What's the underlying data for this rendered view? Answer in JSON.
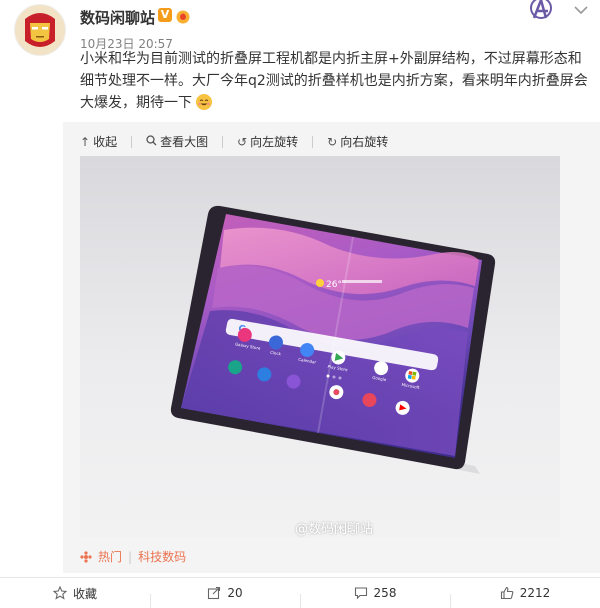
{
  "post": {
    "username": "数码闲聊站",
    "verified_badge": "V",
    "timestamp": "10月23日 20:57",
    "text": "小米和华为目前测试的折叠屏工程机都是内折主屏+外副屏结构，不过屏幕形态和细节处理不一样。大厂今年q2测试的折叠样机也是内折方案，看来明年内折叠屏会大爆发，期待一下"
  },
  "media_toolbar": {
    "collapse": "收起",
    "view_large": "查看大图",
    "rotate_left": "向左旋转",
    "rotate_right": "向右旋转"
  },
  "watermark": "@数码闲聊站",
  "tags": {
    "hot": "热门",
    "category": "科技数码"
  },
  "actions": {
    "favorite": "收藏",
    "repost_count": "20",
    "comment_count": "258",
    "like_count": "2212"
  },
  "phone_apps": [
    "Galaxy Store",
    "Clock",
    "Calendar",
    "Play Store",
    "Google",
    "Microsoft"
  ],
  "weather": "26°",
  "colors": {
    "accent": "#eb7350",
    "badge": "#f59d1b",
    "meta": "#808080"
  }
}
